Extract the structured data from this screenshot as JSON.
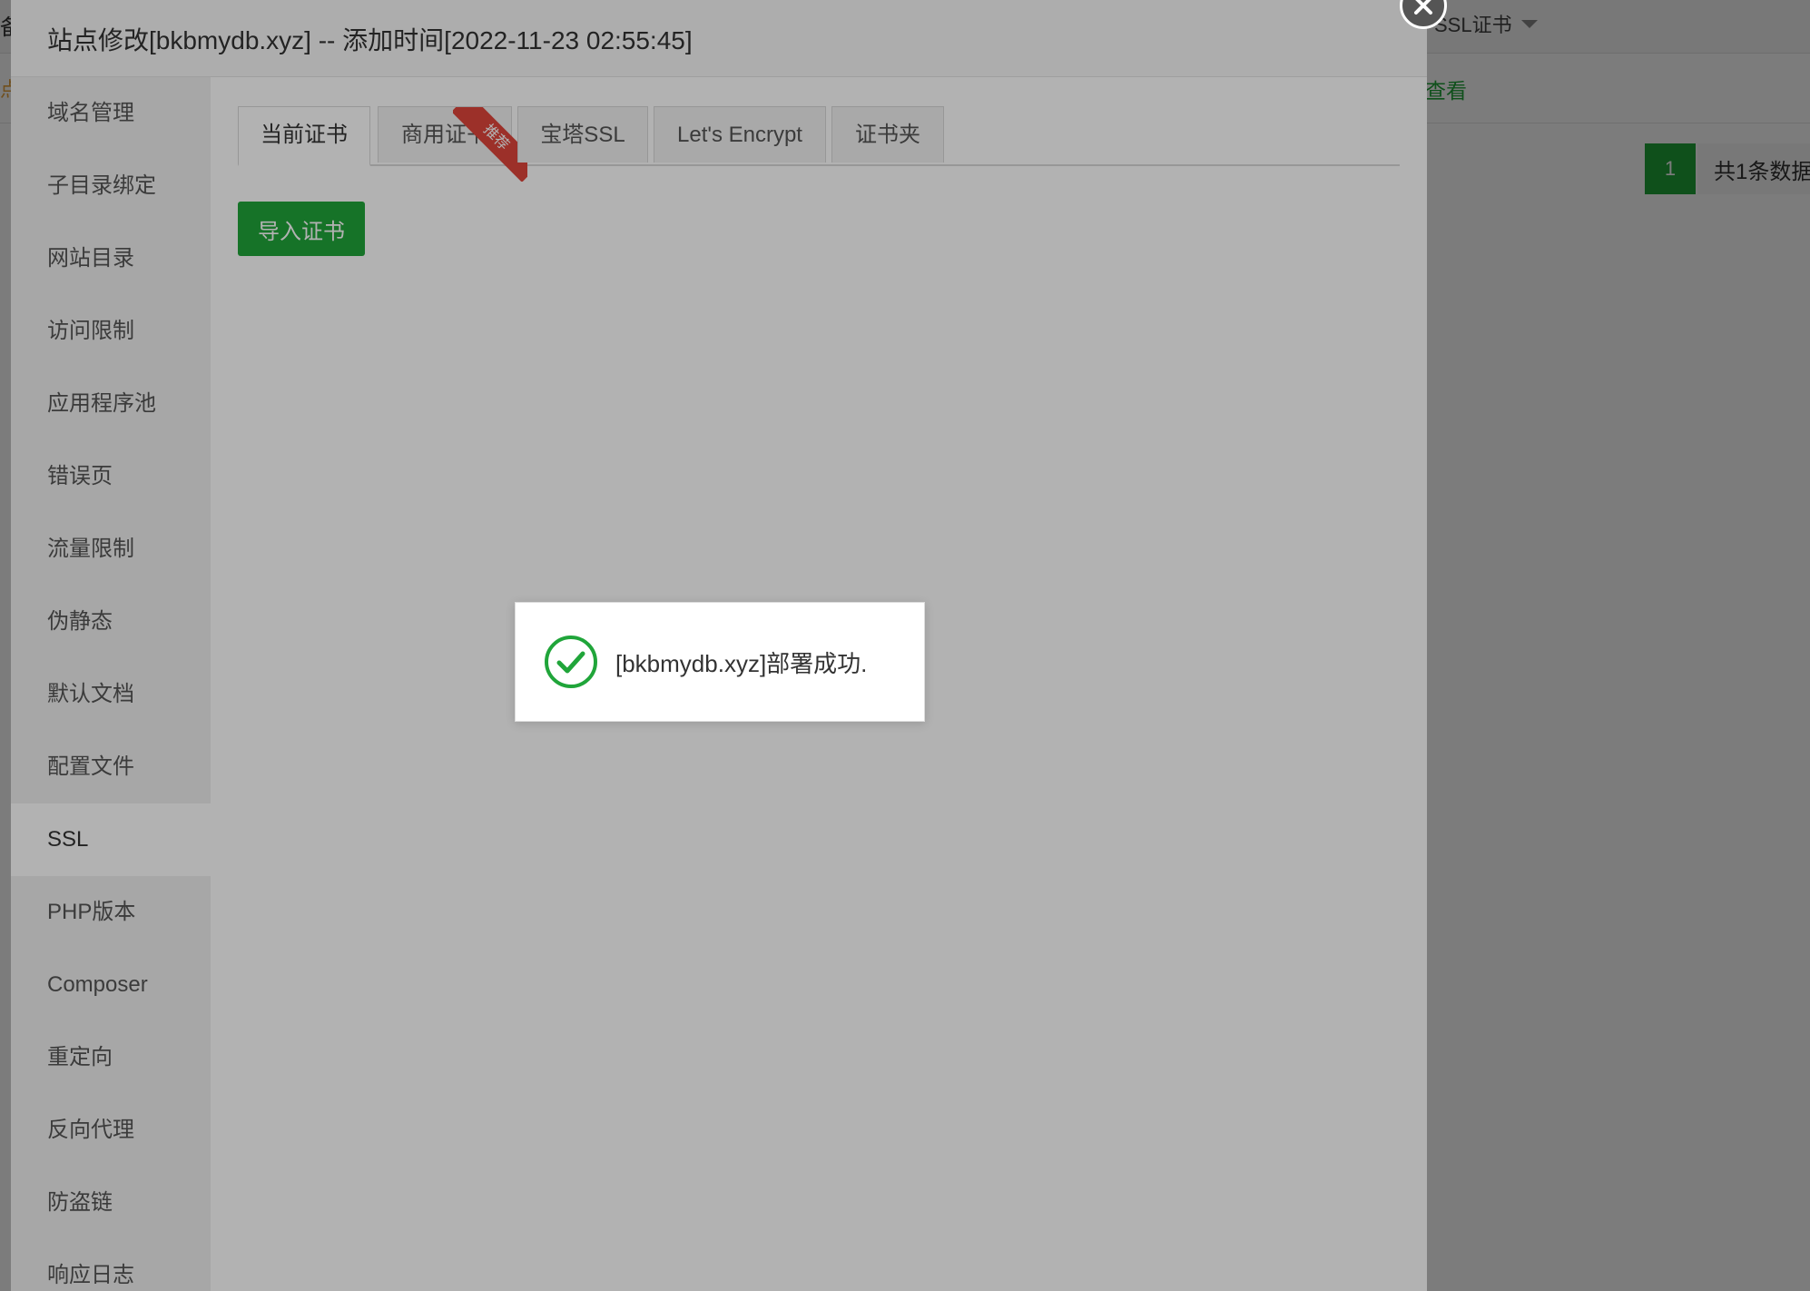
{
  "background_page": {
    "top_left_fragment": "备",
    "row2_left_fragment": "点",
    "ssl_dropdown_label": "SSL证书",
    "view_link": "查看",
    "pagination": {
      "current_page": "1",
      "total_text": "共1条数据"
    }
  },
  "modal": {
    "title": "站点修改[bkbmydb.xyz] -- 添加时间[2022-11-23 02:55:45]",
    "sidebar": {
      "items": [
        {
          "label": "域名管理"
        },
        {
          "label": "子目录绑定"
        },
        {
          "label": "网站目录"
        },
        {
          "label": "访问限制"
        },
        {
          "label": "应用程序池"
        },
        {
          "label": "错误页"
        },
        {
          "label": "流量限制"
        },
        {
          "label": "伪静态"
        },
        {
          "label": "默认文档"
        },
        {
          "label": "配置文件"
        },
        {
          "label": "SSL"
        },
        {
          "label": "PHP版本"
        },
        {
          "label": "Composer"
        },
        {
          "label": "重定向"
        },
        {
          "label": "反向代理"
        },
        {
          "label": "防盗链"
        },
        {
          "label": "响应日志"
        }
      ],
      "active_item": "SSL"
    },
    "tabs": [
      {
        "label": "当前证书"
      },
      {
        "label": "商用证书"
      },
      {
        "label": "宝塔SSL"
      },
      {
        "label": "Let's Encrypt"
      },
      {
        "label": "证书夹"
      }
    ],
    "active_tab": "当前证书",
    "recommend_ribbon": "推荐",
    "import_button": "导入证书"
  },
  "toast": {
    "message": "[bkbmydb.xyz]部署成功.",
    "icon": "check-circle-icon"
  },
  "colors": {
    "accent_green": "#20a53a",
    "ribbon_red": "#e0463c",
    "success_icon": "#20a53a"
  }
}
